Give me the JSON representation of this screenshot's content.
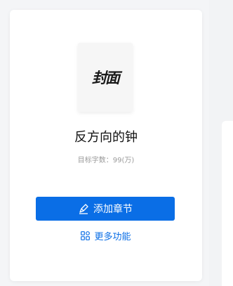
{
  "book": {
    "cover_text": "封面",
    "title": "反方向的钟",
    "word_target_label": "目标字数：99(万)"
  },
  "actions": {
    "add_chapter_label": "添加章节",
    "more_label": "更多功能"
  },
  "colors": {
    "accent": "#0a6ee6",
    "background": "#f4f5f7"
  },
  "icons": {
    "add_chapter": "pen-icon",
    "more": "grid-icon"
  }
}
